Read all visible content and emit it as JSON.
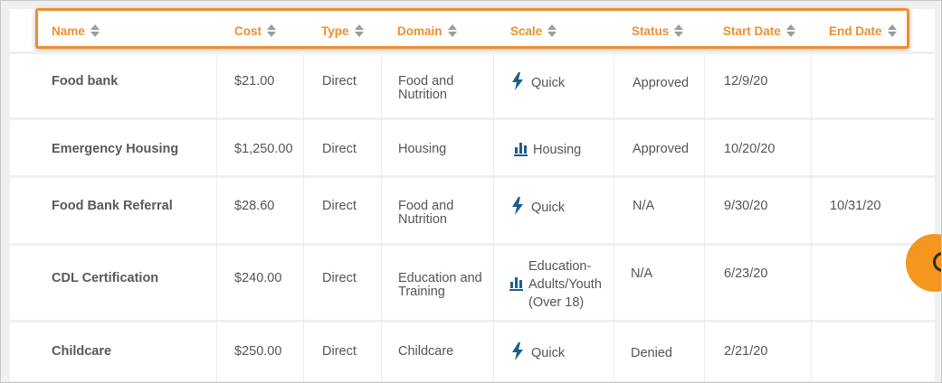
{
  "colors": {
    "accent": "#ef8e2c",
    "icon_blue": "#1b5e8c",
    "help_bubble": "#f5961f"
  },
  "columns": [
    "Name",
    "Cost",
    "Type",
    "Domain",
    "Scale",
    "Status",
    "Start Date",
    "End Date"
  ],
  "rows": [
    {
      "name": "Food bank",
      "cost": "$21.00",
      "type": "Direct",
      "domain": [
        "Food and",
        "Nutrition"
      ],
      "scale_icon": "lightning-icon",
      "scale": [
        "Quick"
      ],
      "status": "Approved",
      "start": "12/9/20",
      "end": ""
    },
    {
      "name": "Emergency Housing",
      "cost": "$1,250.00",
      "type": "Direct",
      "domain": [
        "Housing",
        ""
      ],
      "scale_icon": "bar-chart-icon",
      "scale": [
        "Housing"
      ],
      "status": "Approved",
      "start": "10/20/20",
      "end": ""
    },
    {
      "name": "Food Bank Referral",
      "cost": "$28.60",
      "type": "Direct",
      "domain": [
        "Food and",
        "Nutrition"
      ],
      "scale_icon": "lightning-icon",
      "scale": [
        "Quick"
      ],
      "status": "N/A",
      "start": "9/30/20",
      "end": "10/31/20"
    },
    {
      "name": "CDL Certification",
      "cost": "$240.00",
      "type": "Direct",
      "domain": [
        "Education and",
        "Training"
      ],
      "scale_icon": "bar-chart-icon",
      "scale": [
        "Education-",
        "Adults/Youth",
        "(Over 18)"
      ],
      "status": "N/A",
      "start": "6/23/20",
      "end": ""
    },
    {
      "name": "Childcare",
      "cost": "$250.00",
      "type": "Direct",
      "domain": [
        "Childcare",
        ""
      ],
      "scale_icon": "lightning-icon",
      "scale": [
        "Quick"
      ],
      "status": "Denied",
      "start": "2/21/20",
      "end": ""
    }
  ]
}
